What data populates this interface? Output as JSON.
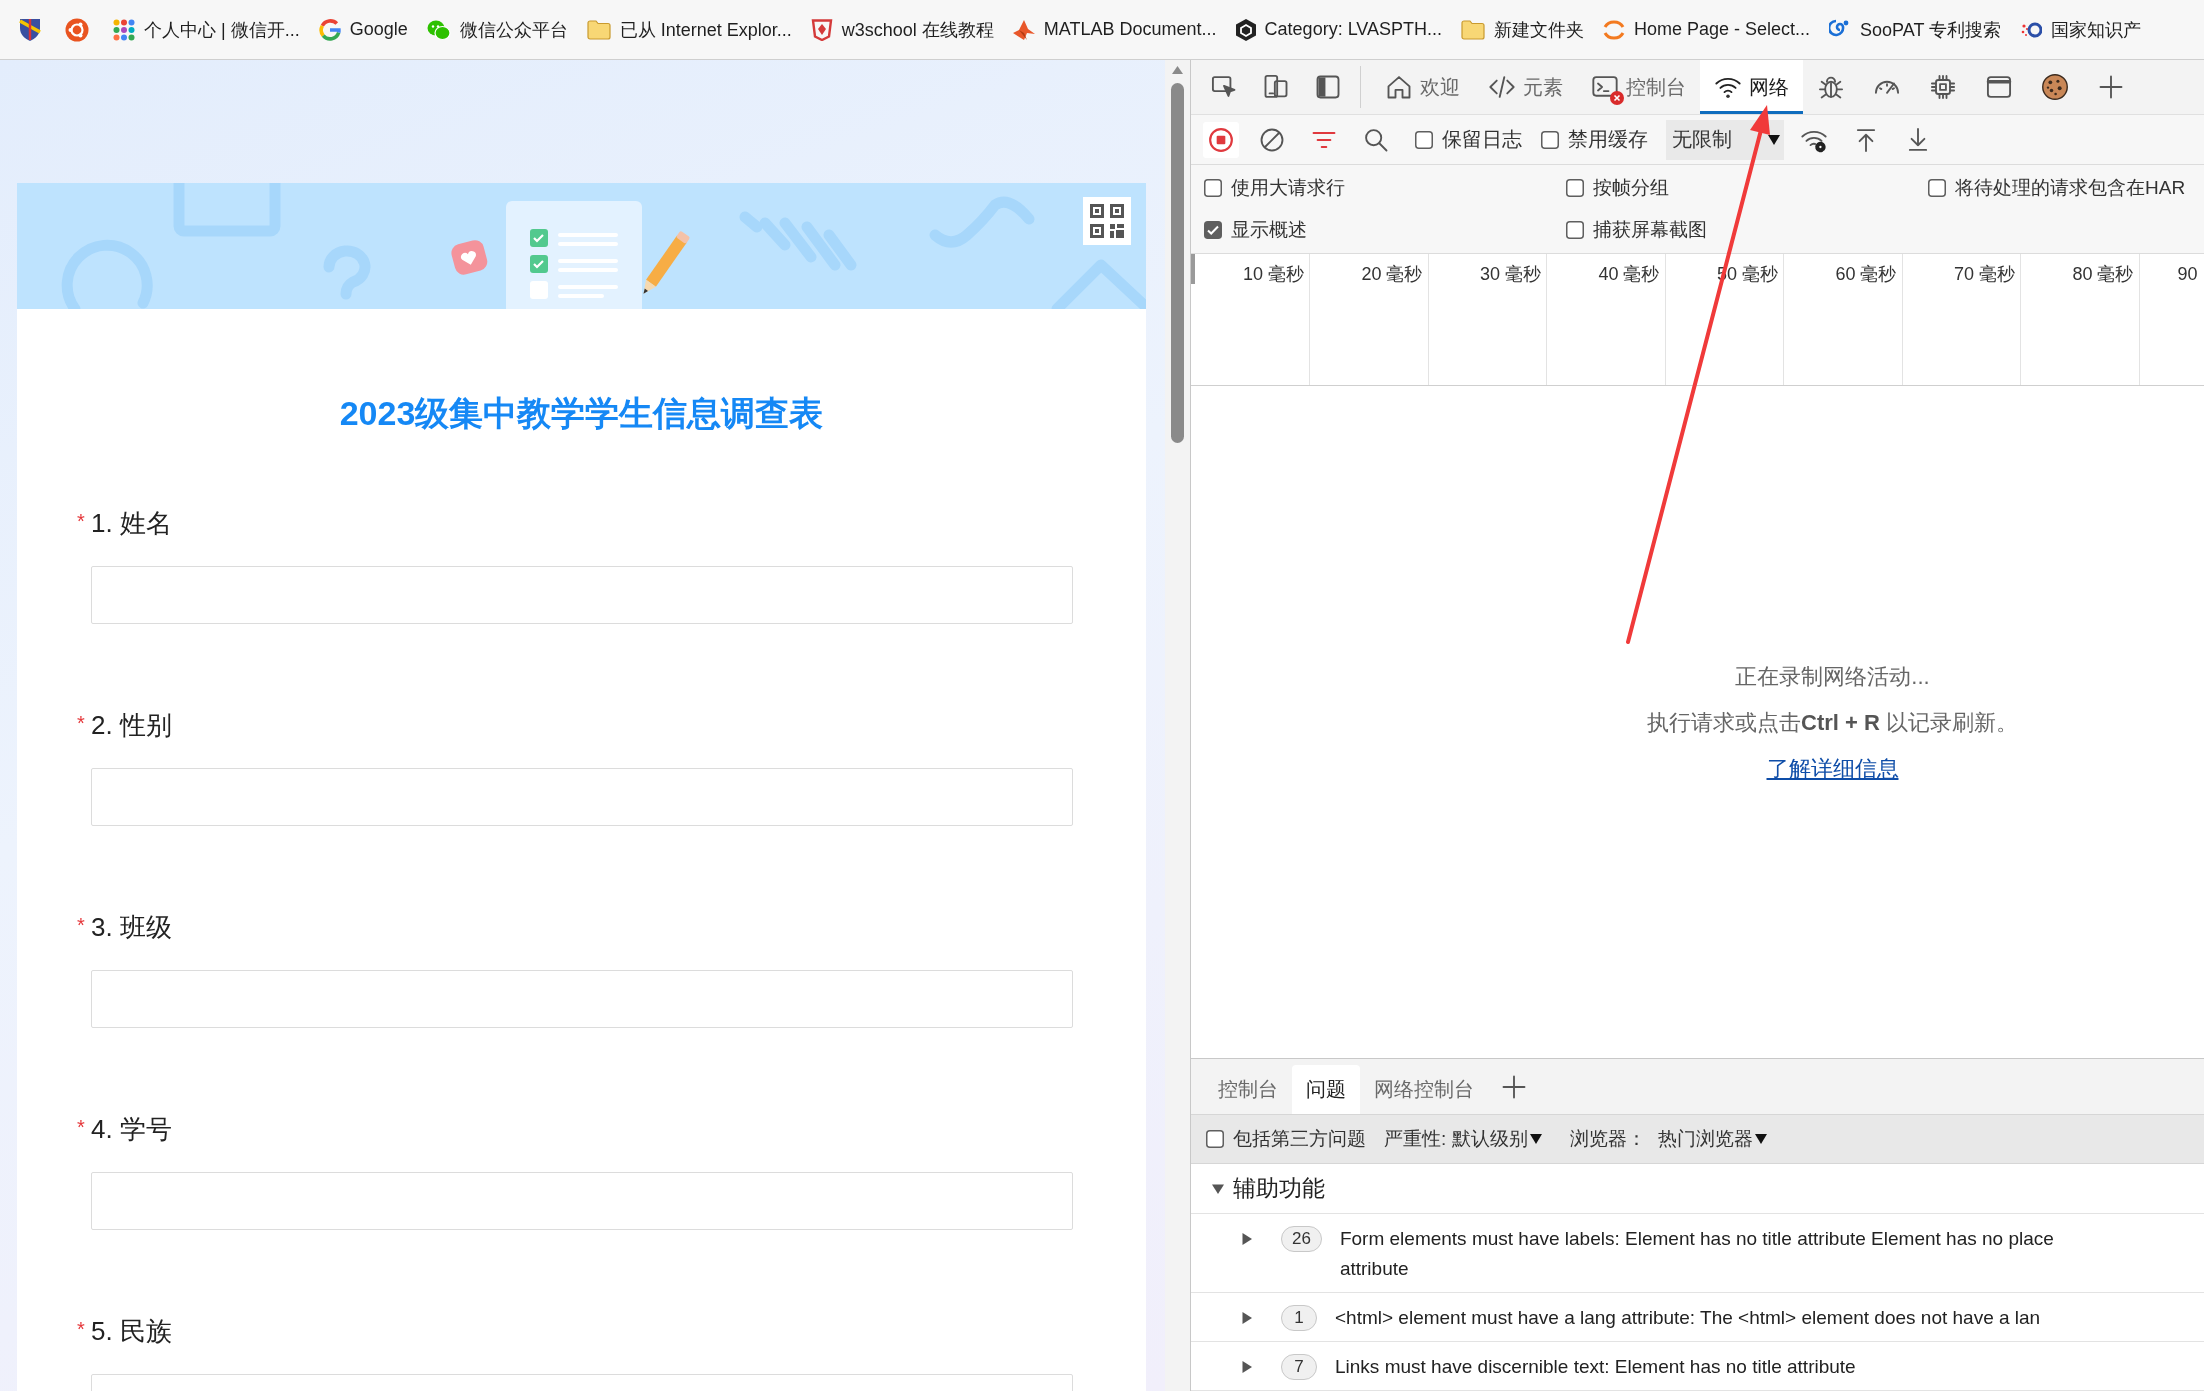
{
  "bookmarks": [
    "个人中心 | 微信开...",
    "Google",
    "微信公众平台",
    "已从 Internet Explor...",
    "w3school 在线教程",
    "MATLAB Document...",
    "Category: LVASPTH...",
    "新建文件夹",
    "Home Page - Select...",
    "SooPAT 专利搜索",
    "国家知识产"
  ],
  "form": {
    "title": "2023级集中教学学生信息调查表",
    "questions": [
      {
        "required_mark": "*",
        "label": "1. 姓名"
      },
      {
        "required_mark": "*",
        "label": "2. 性别"
      },
      {
        "required_mark": "*",
        "label": "3. 班级"
      },
      {
        "required_mark": "*",
        "label": "4. 学号"
      },
      {
        "required_mark": "*",
        "label": "5. 民族"
      }
    ]
  },
  "devtools": {
    "tabs": [
      {
        "label": "欢迎",
        "selected": false,
        "has_errors": false
      },
      {
        "label": "元素",
        "selected": false,
        "has_errors": false
      },
      {
        "label": "控制台",
        "selected": false,
        "has_errors": true
      },
      {
        "label": "网络",
        "selected": true,
        "has_errors": false
      }
    ],
    "toolbar": {
      "recording": true,
      "checkboxes": [
        {
          "label": "保留日志",
          "checked": false
        },
        {
          "label": "禁用缓存",
          "checked": false
        }
      ],
      "throttling": "无限制"
    },
    "settings": [
      {
        "label": "使用大请求行",
        "checked": false
      },
      {
        "label": "按帧分组",
        "checked": false
      },
      {
        "label": "将待处理的请求包含在HAR",
        "checked": false
      },
      {
        "label": "显示概述",
        "checked": true
      },
      {
        "label": "捕获屏幕截图",
        "checked": false
      }
    ],
    "overview_ticks": [
      "10 毫秒",
      "20 毫秒",
      "30 毫秒",
      "40 毫秒",
      "50 毫秒",
      "60 毫秒",
      "70 毫秒",
      "80 毫秒",
      "90"
    ],
    "empty_state": {
      "message": "正在录制网络活动...",
      "hint": "执行请求或点击**Ctrl + R** 以记录刷新。",
      "link": "了解详细信息"
    },
    "drawer": {
      "tabs": [
        {
          "label": "控制台",
          "selected": false
        },
        {
          "label": "问题",
          "selected": true
        },
        {
          "label": "网络控制台",
          "selected": false
        }
      ],
      "filters": {
        "third_party": {
          "label": "包括第三方问题",
          "checked": false
        },
        "severity": "严重性: 默认级别",
        "browser_label": "浏览器：",
        "browser": "热门浏览器"
      },
      "groups": [
        {
          "title": "辅助功能",
          "expanded": true,
          "issues": [
            {
              "count": "26",
              "message": "Form elements must have labels: Element has no title attribute Element has no place\nattribute",
              "expanded": false
            },
            {
              "count": "1",
              "message": "<html> element must have a lang attribute: The <html> element does not have a lan",
              "expanded": false
            },
            {
              "count": "7",
              "message": "Links must have discernible text: Element has no title attribute",
              "expanded": false
            }
          ]
        }
      ]
    }
  }
}
